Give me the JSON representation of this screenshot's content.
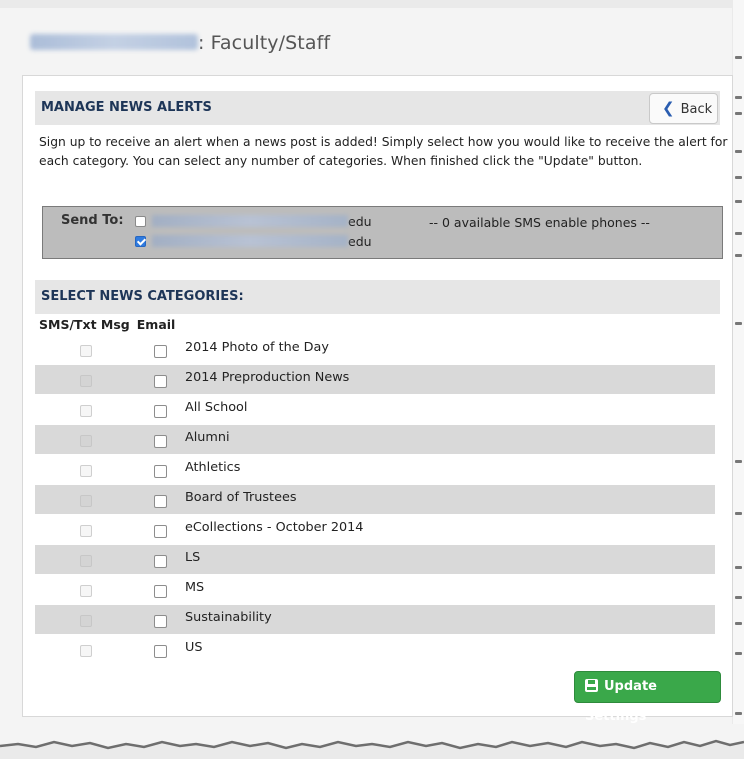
{
  "header": {
    "user_suffix": ": Faculty/Staff"
  },
  "manage": {
    "title": "MANAGE NEWS ALERTS",
    "back_label": "Back",
    "intro": "Sign up to receive an alert when a news post is added! Simply select how you would like to receive the alert for each category. You can select any number of categories. When finished click the \"Update\" button."
  },
  "send_to": {
    "label": "Send To:",
    "emails": [
      {
        "domain": "edu",
        "checked": false
      },
      {
        "domain": "edu",
        "checked": true
      }
    ],
    "sms_note": "-- 0 available SMS enable phones --"
  },
  "categories": {
    "title": "SELECT NEWS CATEGORIES:",
    "col_sms": "SMS/Txt Msg",
    "col_email": "Email",
    "items": [
      {
        "label": "2014 Photo of the Day",
        "sms": false,
        "email": false
      },
      {
        "label": "2014 Preproduction News",
        "sms": false,
        "email": false
      },
      {
        "label": "All School",
        "sms": false,
        "email": false
      },
      {
        "label": "Alumni",
        "sms": false,
        "email": false
      },
      {
        "label": "Athletics",
        "sms": false,
        "email": false
      },
      {
        "label": "Board of Trustees",
        "sms": false,
        "email": false
      },
      {
        "label": "eCollections - October 2014",
        "sms": false,
        "email": false
      },
      {
        "label": "LS",
        "sms": false,
        "email": false
      },
      {
        "label": "MS",
        "sms": false,
        "email": false
      },
      {
        "label": "Sustainability",
        "sms": false,
        "email": false
      },
      {
        "label": "US",
        "sms": false,
        "email": false
      }
    ]
  },
  "footer": {
    "update_label": "Update Settings"
  },
  "colors": {
    "heading": "#1d3557",
    "update_button": "#3aa84a",
    "row_shade": "#d9d9d9",
    "checkbox_checked": "#2f7be0"
  }
}
